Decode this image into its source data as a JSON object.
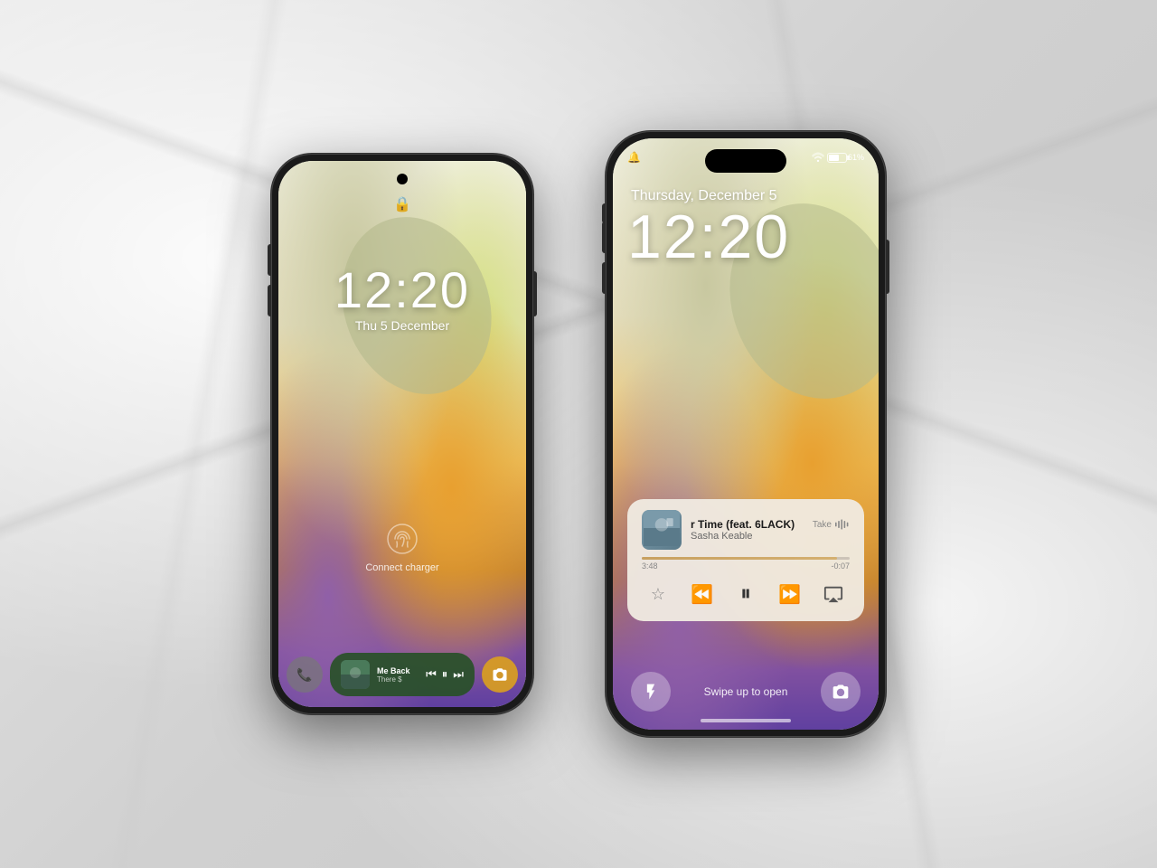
{
  "background": {
    "color": "#d4d4d4",
    "description": "marble white surface"
  },
  "android": {
    "time": "12:20",
    "date": "Thu 5 December",
    "lock_icon": "🔒",
    "fingerprint_hint": "fingerprint",
    "connect_charger": "Connect charger",
    "music_widget": {
      "song_title": "Me Back",
      "song_subtitle": "There $",
      "album_art_color": "#4a7a6a"
    },
    "phone_btn": "📞",
    "camera_btn": "📷"
  },
  "iphone": {
    "date": "Thursday, December 5",
    "time": "12:20",
    "status": {
      "left_icon": "🔔",
      "wifi": "wifi",
      "battery": "61%"
    },
    "music_player": {
      "song_title": "r Time (feat. 6LACK)",
      "song_label": "Take",
      "artist": "Sasha Keable",
      "time_elapsed": "3:48",
      "time_remaining": "-0:07",
      "progress_percent": 94
    },
    "swipe_text": "Swipe up to open",
    "torch_icon": "🔦",
    "camera_icon": "📷"
  }
}
